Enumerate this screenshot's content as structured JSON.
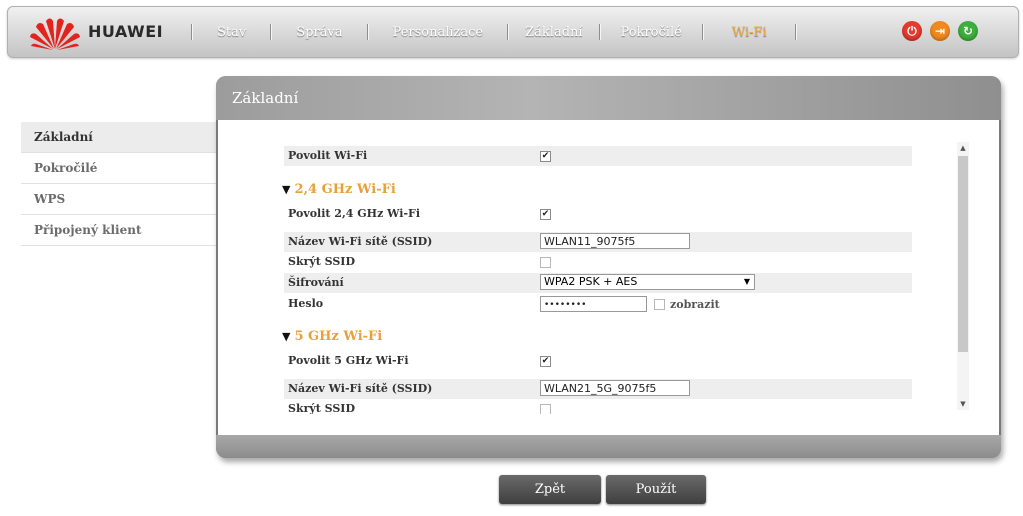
{
  "header": {
    "brand": "HUAWEI",
    "nav": [
      "Stav",
      "Správa",
      "Personalizace",
      "Základní",
      "Pokročilé",
      "Wi-Fi"
    ],
    "active_nav": "Wi-Fi",
    "icons": [
      "power-icon",
      "logout-icon",
      "refresh-icon"
    ]
  },
  "sidebar": {
    "items": [
      {
        "label": "Základní",
        "active": true
      },
      {
        "label": "Pokročilé",
        "active": false
      },
      {
        "label": "WPS",
        "active": false
      },
      {
        "label": "Připojený klient",
        "active": false
      }
    ]
  },
  "panel": {
    "title": "Základní",
    "enable_wifi": {
      "label": "Povolit Wi-Fi",
      "checked": true
    },
    "band24": {
      "heading": "2,4 GHz Wi-Fi",
      "enable_label": "Povolit 2,4 GHz Wi-Fi",
      "enable_checked": true,
      "ssid_label": "Název Wi-Fi sítě (SSID)",
      "ssid_value": "WLAN11_9075f5",
      "hide_label": "Skrýt SSID",
      "hide_checked": false,
      "security_label": "Šifrování",
      "security_value": "WPA2 PSK + AES",
      "password_label": "Heslo",
      "password_value": "••••••••",
      "show_label": "zobrazit"
    },
    "band5": {
      "heading": "5 GHz Wi-Fi",
      "enable_label": "Povolit 5 GHz Wi-Fi",
      "enable_checked": true,
      "ssid_label": "Název Wi-Fi sítě (SSID)",
      "ssid_value": "WLAN21_5G_9075f5",
      "hide_label": "Skrýt SSID"
    }
  },
  "buttons": {
    "back": "Zpět",
    "apply": "Použít"
  },
  "colors": {
    "accent": "#e8a03a",
    "active_nav": "#f1a93a"
  }
}
